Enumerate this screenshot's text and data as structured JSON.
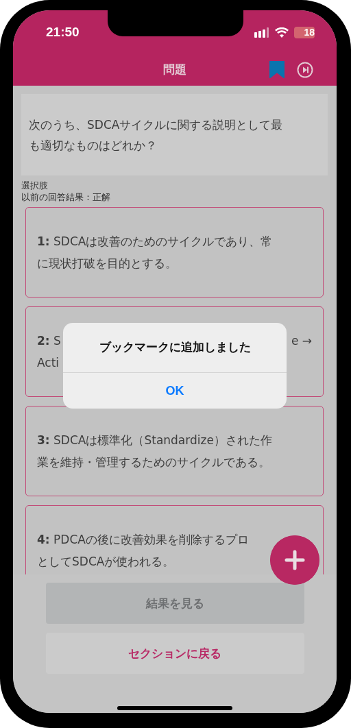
{
  "status_bar": {
    "time": "21:50",
    "battery": "18"
  },
  "header": {
    "title": "問題",
    "bookmarked": true
  },
  "question": {
    "lines": [
      "次のうち、SDCAサイクルに関する説明として最",
      "も適切なものはどれか？"
    ]
  },
  "labels": [
    "選択肢",
    "以前の回答結果：正解"
  ],
  "options": [
    {
      "kind": "full",
      "lines": [
        "**1:** SDCAは改善のためのサイクルであり、常",
        "に現状打破を目的とする。"
      ]
    },
    {
      "kind": "obscured",
      "fragments": [
        "**2:** S",
        "e →",
        "Acti"
      ]
    },
    {
      "kind": "full",
      "lines": [
        "**3:** SDCAは標準化（Standardize）された作",
        "業を維持・管理するためのサイクルである。"
      ]
    },
    {
      "kind": "full",
      "lines": [
        "**4:** PDCAの後に改善効果を削除するプロ",
        "としてSDCAが使われる。"
      ]
    }
  ],
  "buttons": [
    {
      "label": "結果を見る",
      "disabled": true
    },
    {
      "label": "セクションに戻る",
      "disabled": false
    }
  ],
  "alert": {
    "title": "ブックマークに追加しました",
    "button": "OK"
  }
}
